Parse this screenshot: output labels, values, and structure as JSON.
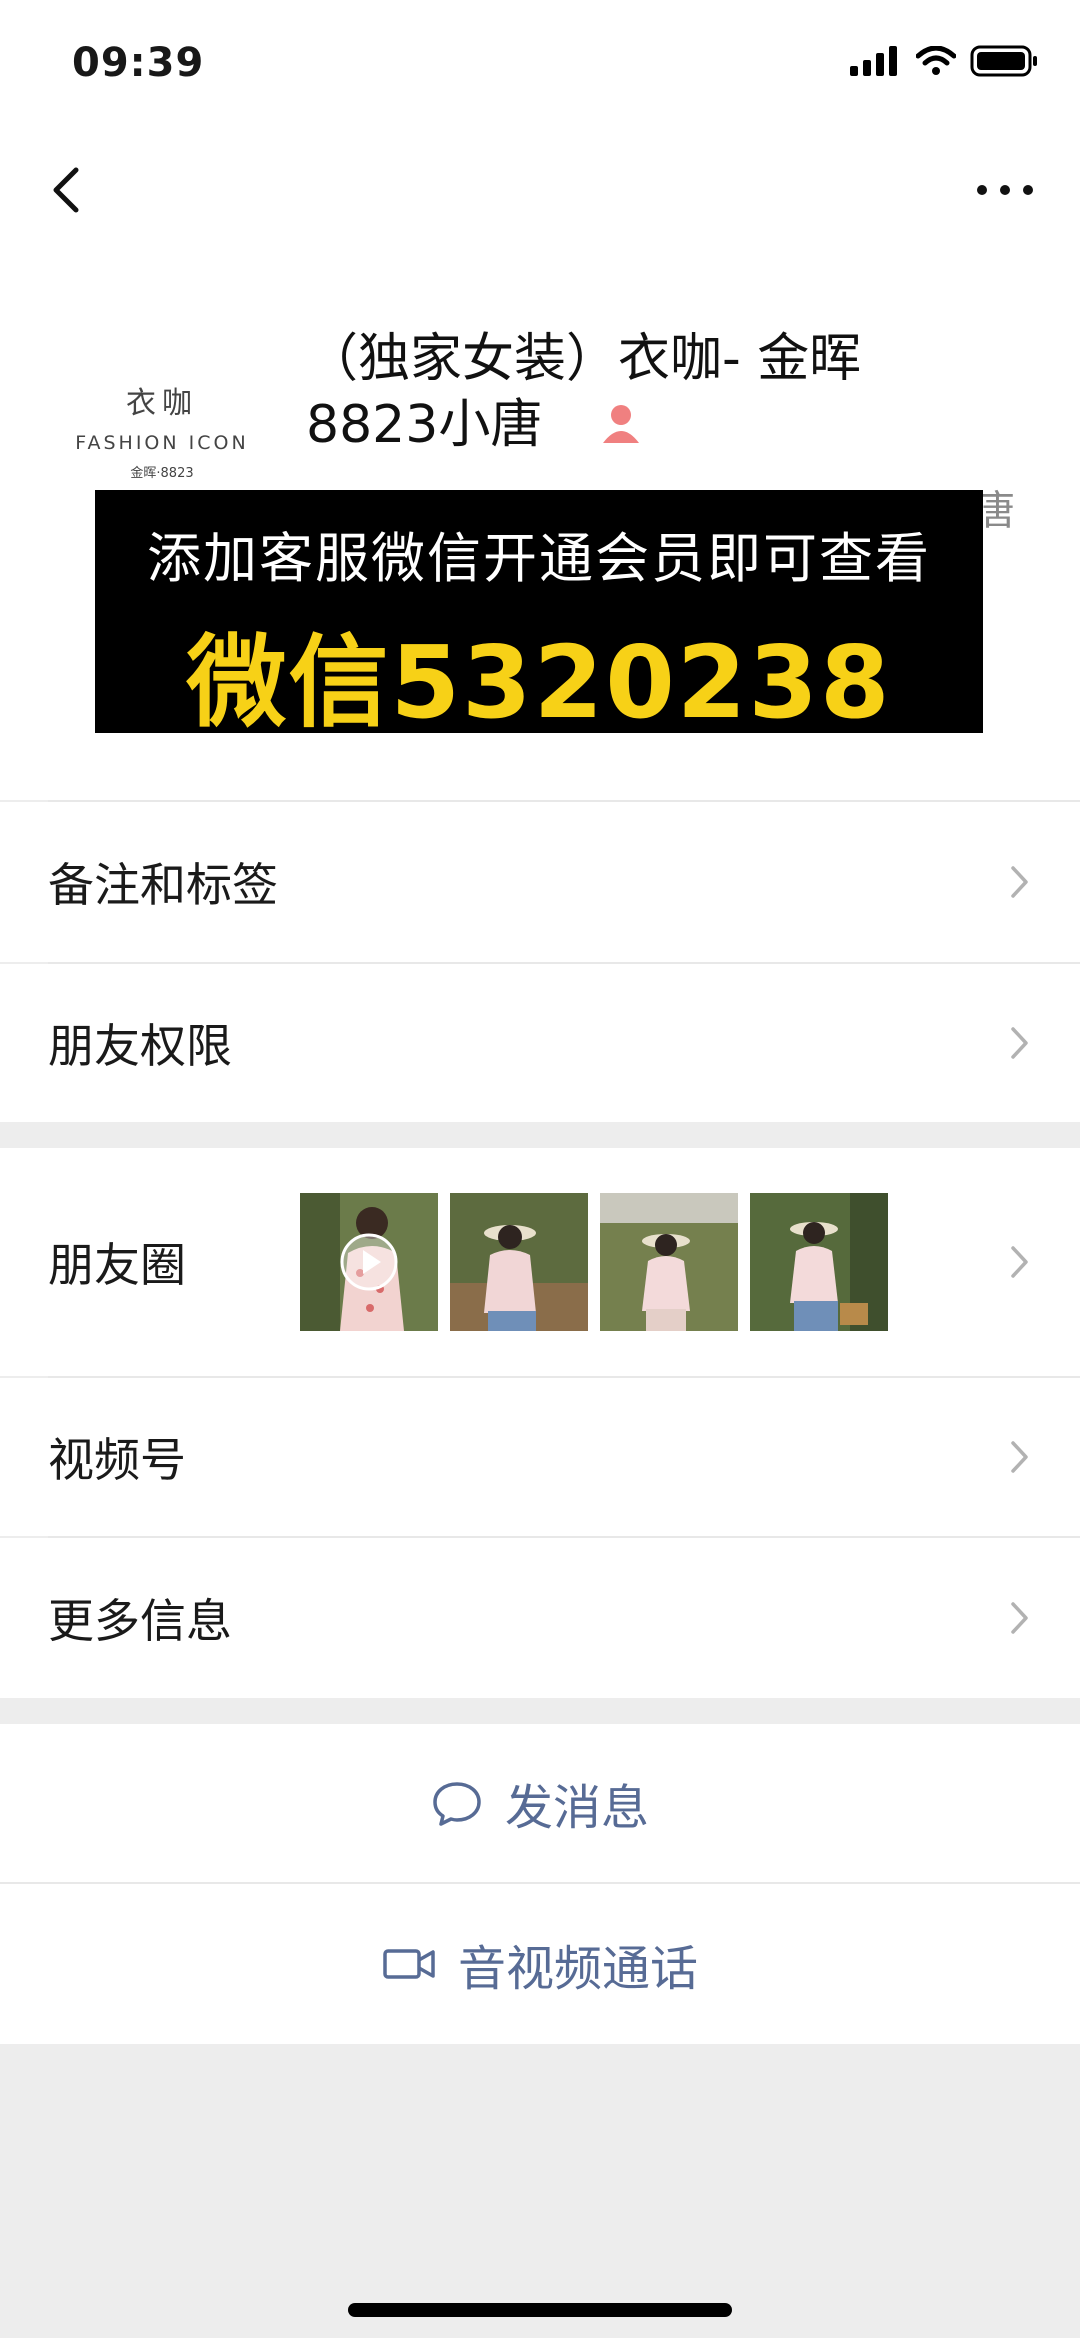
{
  "status_bar": {
    "time": "09:39"
  },
  "profile": {
    "avatar": {
      "cn": "衣咖",
      "en": "FASHION ICON",
      "sub": "金晖·8823"
    },
    "name": "（独家女装）衣咖- 金晖8823小唐",
    "sub_text": "昵称：（独家女装）衣咖- 金晖8823小唐 替上"
  },
  "promo": {
    "line1": "添加客服微信开通会员即可查看",
    "line2": "微信5320238"
  },
  "menu": {
    "notes_tags": "备注和标签",
    "friend_permissions": "朋友权限",
    "moments": "朋友圈",
    "channels": "视频号",
    "more_info": "更多信息"
  },
  "actions": {
    "send_message": "发消息",
    "video_call": "音视频通话"
  },
  "colors": {
    "link": "#576b95",
    "promo_yellow": "#f7d117",
    "background": "#ededed"
  }
}
